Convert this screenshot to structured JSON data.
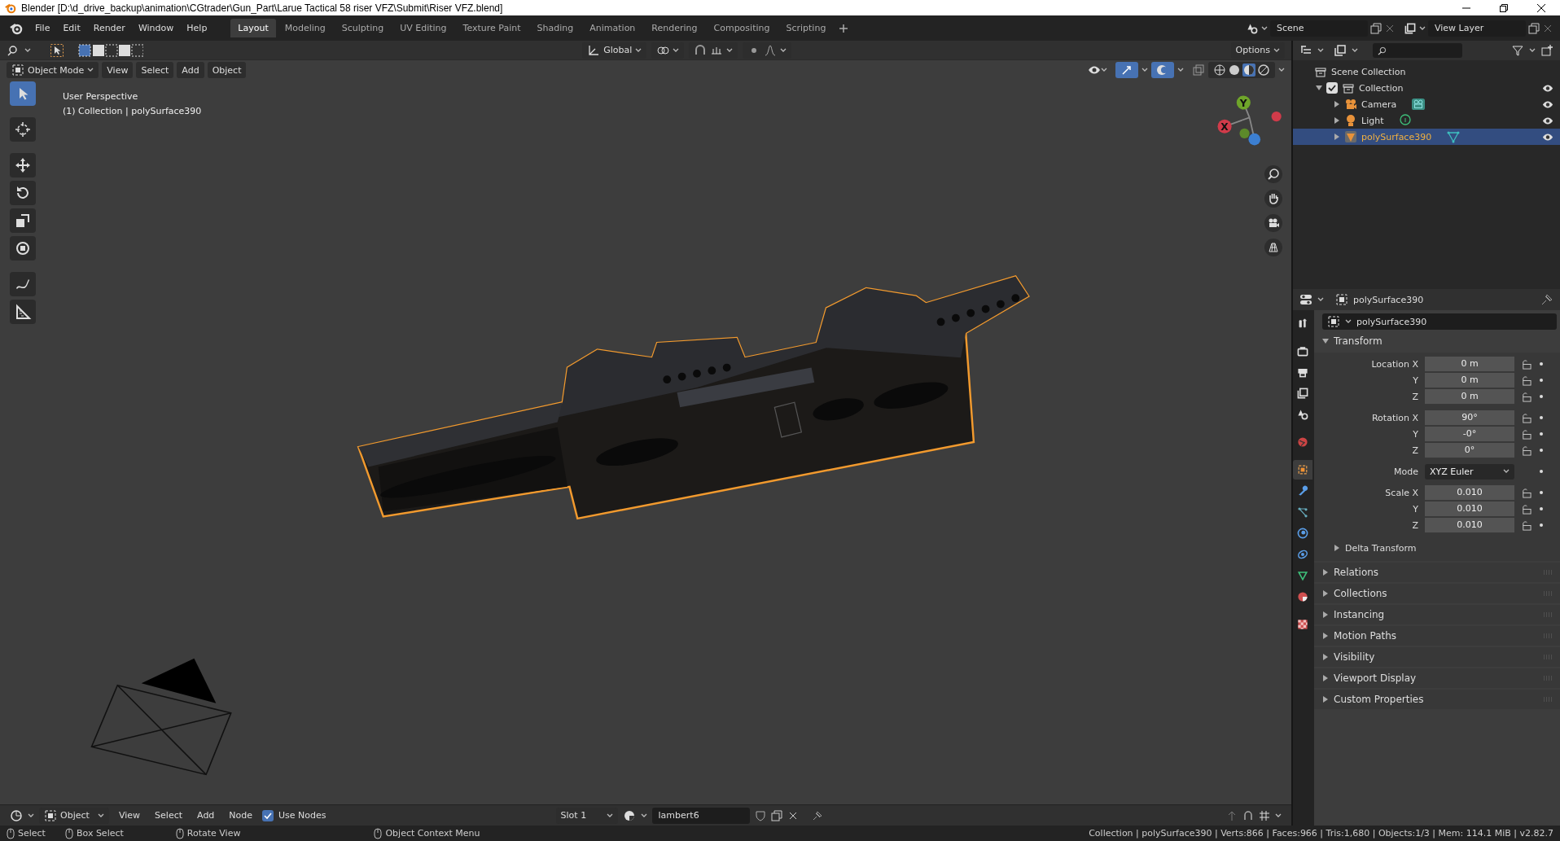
{
  "window": {
    "title": "Blender [D:\\d_drive_backup\\animation\\CGtrader\\Gun_Part\\Larue Tactical 58 riser VFZ\\Submit\\Riser VFZ.blend]"
  },
  "menu": [
    "File",
    "Edit",
    "Render",
    "Window",
    "Help"
  ],
  "workspaces": [
    {
      "label": "Layout",
      "selected": true
    },
    {
      "label": "Modeling",
      "selected": false
    },
    {
      "label": "Sculpting",
      "selected": false
    },
    {
      "label": "UV Editing",
      "selected": false
    },
    {
      "label": "Texture Paint",
      "selected": false
    },
    {
      "label": "Shading",
      "selected": false
    },
    {
      "label": "Animation",
      "selected": false
    },
    {
      "label": "Rendering",
      "selected": false
    },
    {
      "label": "Compositing",
      "selected": false
    },
    {
      "label": "Scripting",
      "selected": false
    }
  ],
  "scene": "Scene",
  "view_layer": "View Layer",
  "viewport": {
    "orientation": "Global",
    "options": "Options",
    "mode": "Object Mode",
    "menus": [
      "View",
      "Select",
      "Add",
      "Object"
    ],
    "tools": [
      {
        "kind": "select",
        "selected": true
      },
      {
        "kind": "cursor",
        "selected": false
      },
      {
        "kind": "move",
        "selected": false
      },
      {
        "kind": "rotate",
        "selected": false
      },
      {
        "kind": "scale",
        "selected": false
      },
      {
        "kind": "transform",
        "selected": false
      },
      {
        "kind": "annotate",
        "selected": false
      },
      {
        "kind": "measure",
        "selected": false
      }
    ],
    "info": [
      "User Perspective",
      "(1) Collection | polySurface390"
    ],
    "gizmo_axes": [
      "Y",
      "X"
    ]
  },
  "outliner": {
    "root": "Scene Collection",
    "items": [
      {
        "label": "Collection",
        "kind": "collection",
        "checked": true,
        "expanded": true,
        "selected": false,
        "children": [
          {
            "label": "Camera",
            "kind": "camera",
            "selected": false
          },
          {
            "label": "Light",
            "kind": "light",
            "selected": false
          },
          {
            "label": "polySurface390",
            "kind": "mesh",
            "selected": true
          }
        ]
      }
    ]
  },
  "properties": {
    "header": "polySurface390",
    "object_name": "polySurface390",
    "tabs": [
      {
        "kind": "tool",
        "selected": false
      },
      {
        "kind": "render",
        "selected": false
      },
      {
        "kind": "output",
        "selected": false
      },
      {
        "kind": "view_layer",
        "selected": false
      },
      {
        "kind": "scene",
        "selected": false
      },
      {
        "kind": "world",
        "selected": false
      },
      {
        "kind": "object",
        "selected": true
      },
      {
        "kind": "modifiers",
        "selected": false
      },
      {
        "kind": "particles",
        "selected": false
      },
      {
        "kind": "physics",
        "selected": false
      },
      {
        "kind": "constraints",
        "selected": false
      },
      {
        "kind": "data",
        "selected": false
      },
      {
        "kind": "material",
        "selected": false
      },
      {
        "kind": "texture",
        "selected": false
      }
    ],
    "transform": {
      "title": "Transform",
      "expanded": true,
      "groups": [
        {
          "rows": [
            {
              "label": "Location X",
              "value": "0 m"
            },
            {
              "label": "Y",
              "value": "0 m"
            },
            {
              "label": "Z",
              "value": "0 m"
            }
          ]
        },
        {
          "rows": [
            {
              "label": "Rotation X",
              "value": "90°"
            },
            {
              "label": "Y",
              "value": "-0°"
            },
            {
              "label": "Z",
              "value": "0°"
            }
          ]
        },
        {
          "mode_label": "Mode",
          "mode": "XYZ Euler"
        },
        {
          "rows": [
            {
              "label": "Scale X",
              "value": "0.010"
            },
            {
              "label": "Y",
              "value": "0.010"
            },
            {
              "label": "Z",
              "value": "0.010"
            }
          ]
        }
      ],
      "subpanel": "Delta Transform"
    },
    "panels": [
      "Relations",
      "Collections",
      "Instancing",
      "Motion Paths",
      "Visibility",
      "Viewport Display",
      "Custom Properties"
    ]
  },
  "shader_header": {
    "editor": "Object",
    "menus": [
      "View",
      "Select",
      "Add",
      "Node"
    ],
    "use_nodes": {
      "label": "Use Nodes",
      "checked": true
    },
    "slot": "Slot 1",
    "material": "lambert6"
  },
  "status_bar": {
    "hints": [
      "Select",
      "Box Select",
      "Rotate View",
      "Object Context Menu"
    ],
    "stats": "Collection | polySurface390 | Verts:866 | Faces:966 | Tris:1,680 | Objects:1/3 | Mem: 114.1 MiB | v2.82.7"
  }
}
